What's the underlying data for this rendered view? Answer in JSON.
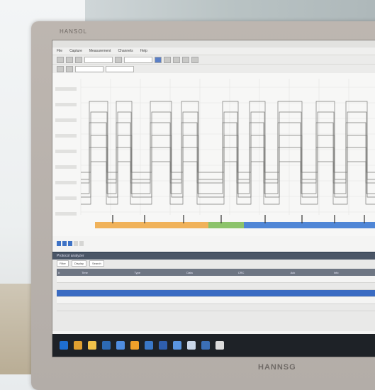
{
  "monitor": {
    "brand_top": "HANSOL",
    "brand_bottom": "HANNSG"
  },
  "app": {
    "title": "",
    "menu": [
      "File",
      "Capture",
      "Measurement",
      "Channels",
      "Help"
    ]
  },
  "bus_tabs": [
    "",
    "",
    "",
    "",
    ""
  ],
  "panel": {
    "title": "Protocol analyzer",
    "bar_items": [
      "Filter",
      "Display",
      "Search"
    ]
  },
  "table": {
    "columns": [
      "#",
      "Time",
      "Type",
      "Data",
      "CRC",
      "Ack",
      "Info"
    ],
    "rows": [
      [
        "",
        "",
        "",
        "",
        "",
        "",
        ""
      ],
      [
        "",
        "",
        "",
        "",
        "",
        "",
        ""
      ],
      [
        "",
        "",
        "",
        "",
        "",
        "",
        ""
      ],
      [
        "",
        "",
        "",
        "",
        "",
        "",
        ""
      ],
      [
        "",
        "",
        "",
        "",
        "",
        "",
        ""
      ]
    ]
  },
  "taskbar_icons": [
    "start-icon",
    "chrome-icon",
    "folder-icon",
    "app-icon",
    "app-icon",
    "app-icon",
    "app-icon",
    "app-icon",
    "app-icon",
    "app-icon",
    "app-icon",
    "app-icon"
  ],
  "colors": {
    "accent": "#3f73c6",
    "bus_orange": "#f0b25a",
    "bus_green": "#8cc36b",
    "bus_blue": "#4f86d6"
  }
}
